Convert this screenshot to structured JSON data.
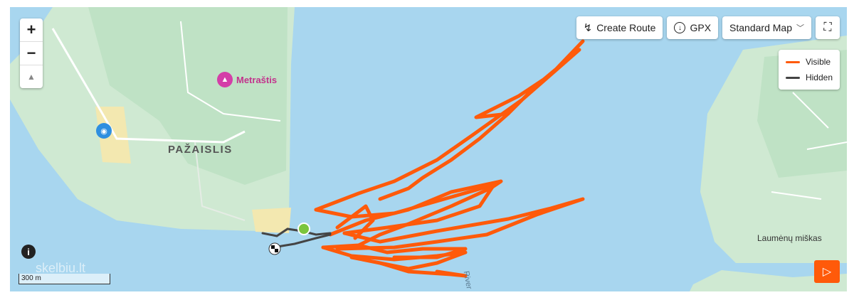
{
  "map": {
    "place_label": "PAŽAISLIS",
    "poi_label": "Metraštis",
    "forest_label": "Laumėnų miškas",
    "river_label": "River",
    "scale_label": "300 m",
    "watermark": "skelbiu.lt"
  },
  "controls": {
    "zoom_in": "+",
    "zoom_out": "−",
    "compass": "▲"
  },
  "toolbar": {
    "create_route": "Create Route",
    "gpx": "GPX",
    "map_type": "Standard Map",
    "fullscreen_icon": "⛶"
  },
  "legend": {
    "items": [
      {
        "label": "Visible",
        "color": "#ff5a0a"
      },
      {
        "label": "Hidden",
        "color": "#444444"
      }
    ]
  },
  "colors": {
    "water": "#a8d6ef",
    "land": "#cfe9d2",
    "forest": "#b9dfbf",
    "track": "#ff5a0a",
    "hidden_track": "#444444"
  }
}
